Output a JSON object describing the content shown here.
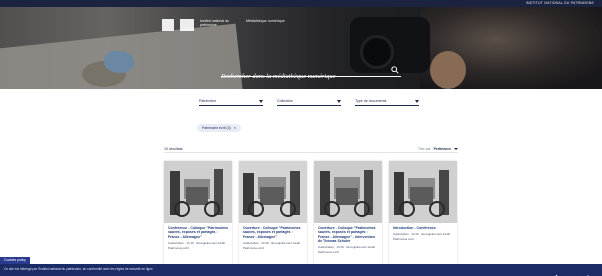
{
  "topbar": {
    "institution": "INSTITUT NATIONAL DU PATRIMOINE"
  },
  "hero": {
    "logo_text_1": "Institut national du patrimoine",
    "logo_text_2": "Médiathèque numérique",
    "search_placeholder": "Rechercher dans la médiathèque numérique"
  },
  "filters": [
    {
      "label": "Patrimoine"
    },
    {
      "label": "Collection"
    },
    {
      "label": "Type de documents"
    }
  ],
  "active_filter": {
    "label": "Patrimoine écrit (3)"
  },
  "results": {
    "count": "10 résultats",
    "sort_label": "Trier par",
    "sort_value": "Pertinence"
  },
  "cards": [
    {
      "title": "Conférence - Colloque \"Patrimoines sauvés, exposés et partagés : France - Allemagne\"",
      "meta": "Audio/vidéo · 1h 10 · Enregistrement inédit",
      "pages": "Patrimoine écrit"
    },
    {
      "title": "Ouverture - Colloque \"Patrimoines sauvés, exposés et partagés : France - Allemagne\"",
      "meta": "Audio/vidéo · 1h 00 · Enregistrement inédit",
      "pages": "Patrimoine écrit"
    },
    {
      "title": "Ouverture - Colloque \"Patrimoines sauvés, exposés et partagés : France - Allemagne\" - Intervention de Thomas Schuler",
      "meta": "Audio/vidéo · 1h 00 · Enregistrement inédit",
      "pages": "Patrimoine écrit"
    },
    {
      "title": "Introduction - Conférence",
      "meta": "Audio/vidéo · 1h 00 · Enregistrement inédit",
      "pages": "Patrimoine écrit"
    }
  ],
  "cookie": {
    "label": "Cookies policy"
  },
  "footer": {
    "message": "Ce site est hébergé par l'Institut national du patrimoine, en conformité avec les règles de sécurité en ligne"
  },
  "colors": {
    "navy": "#1b2340",
    "footer": "#1b2b66",
    "accent": "#2a3a8f",
    "title_link": "#1e3a7a"
  }
}
